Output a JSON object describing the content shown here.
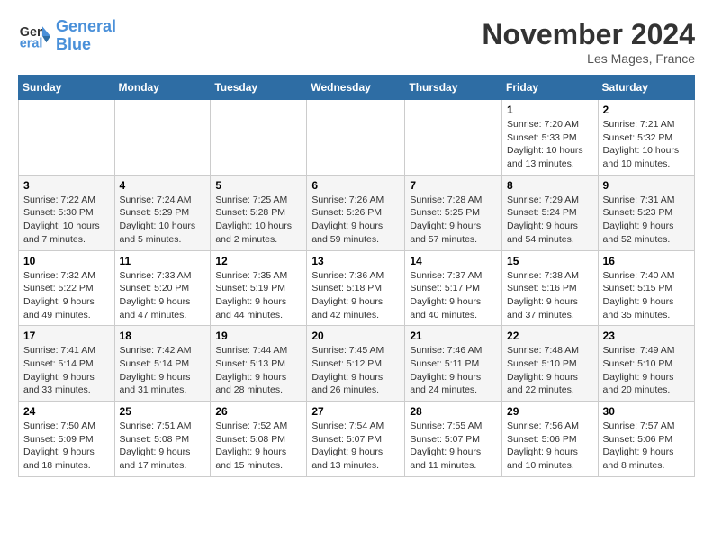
{
  "logo": {
    "line1": "General",
    "line2": "Blue"
  },
  "title": "November 2024",
  "location": "Les Mages, France",
  "days_of_week": [
    "Sunday",
    "Monday",
    "Tuesday",
    "Wednesday",
    "Thursday",
    "Friday",
    "Saturday"
  ],
  "weeks": [
    [
      {
        "day": "",
        "info": ""
      },
      {
        "day": "",
        "info": ""
      },
      {
        "day": "",
        "info": ""
      },
      {
        "day": "",
        "info": ""
      },
      {
        "day": "",
        "info": ""
      },
      {
        "day": "1",
        "info": "Sunrise: 7:20 AM\nSunset: 5:33 PM\nDaylight: 10 hours\nand 13 minutes."
      },
      {
        "day": "2",
        "info": "Sunrise: 7:21 AM\nSunset: 5:32 PM\nDaylight: 10 hours\nand 10 minutes."
      }
    ],
    [
      {
        "day": "3",
        "info": "Sunrise: 7:22 AM\nSunset: 5:30 PM\nDaylight: 10 hours\nand 7 minutes."
      },
      {
        "day": "4",
        "info": "Sunrise: 7:24 AM\nSunset: 5:29 PM\nDaylight: 10 hours\nand 5 minutes."
      },
      {
        "day": "5",
        "info": "Sunrise: 7:25 AM\nSunset: 5:28 PM\nDaylight: 10 hours\nand 2 minutes."
      },
      {
        "day": "6",
        "info": "Sunrise: 7:26 AM\nSunset: 5:26 PM\nDaylight: 9 hours\nand 59 minutes."
      },
      {
        "day": "7",
        "info": "Sunrise: 7:28 AM\nSunset: 5:25 PM\nDaylight: 9 hours\nand 57 minutes."
      },
      {
        "day": "8",
        "info": "Sunrise: 7:29 AM\nSunset: 5:24 PM\nDaylight: 9 hours\nand 54 minutes."
      },
      {
        "day": "9",
        "info": "Sunrise: 7:31 AM\nSunset: 5:23 PM\nDaylight: 9 hours\nand 52 minutes."
      }
    ],
    [
      {
        "day": "10",
        "info": "Sunrise: 7:32 AM\nSunset: 5:22 PM\nDaylight: 9 hours\nand 49 minutes."
      },
      {
        "day": "11",
        "info": "Sunrise: 7:33 AM\nSunset: 5:20 PM\nDaylight: 9 hours\nand 47 minutes."
      },
      {
        "day": "12",
        "info": "Sunrise: 7:35 AM\nSunset: 5:19 PM\nDaylight: 9 hours\nand 44 minutes."
      },
      {
        "day": "13",
        "info": "Sunrise: 7:36 AM\nSunset: 5:18 PM\nDaylight: 9 hours\nand 42 minutes."
      },
      {
        "day": "14",
        "info": "Sunrise: 7:37 AM\nSunset: 5:17 PM\nDaylight: 9 hours\nand 40 minutes."
      },
      {
        "day": "15",
        "info": "Sunrise: 7:38 AM\nSunset: 5:16 PM\nDaylight: 9 hours\nand 37 minutes."
      },
      {
        "day": "16",
        "info": "Sunrise: 7:40 AM\nSunset: 5:15 PM\nDaylight: 9 hours\nand 35 minutes."
      }
    ],
    [
      {
        "day": "17",
        "info": "Sunrise: 7:41 AM\nSunset: 5:14 PM\nDaylight: 9 hours\nand 33 minutes."
      },
      {
        "day": "18",
        "info": "Sunrise: 7:42 AM\nSunset: 5:14 PM\nDaylight: 9 hours\nand 31 minutes."
      },
      {
        "day": "19",
        "info": "Sunrise: 7:44 AM\nSunset: 5:13 PM\nDaylight: 9 hours\nand 28 minutes."
      },
      {
        "day": "20",
        "info": "Sunrise: 7:45 AM\nSunset: 5:12 PM\nDaylight: 9 hours\nand 26 minutes."
      },
      {
        "day": "21",
        "info": "Sunrise: 7:46 AM\nSunset: 5:11 PM\nDaylight: 9 hours\nand 24 minutes."
      },
      {
        "day": "22",
        "info": "Sunrise: 7:48 AM\nSunset: 5:10 PM\nDaylight: 9 hours\nand 22 minutes."
      },
      {
        "day": "23",
        "info": "Sunrise: 7:49 AM\nSunset: 5:10 PM\nDaylight: 9 hours\nand 20 minutes."
      }
    ],
    [
      {
        "day": "24",
        "info": "Sunrise: 7:50 AM\nSunset: 5:09 PM\nDaylight: 9 hours\nand 18 minutes."
      },
      {
        "day": "25",
        "info": "Sunrise: 7:51 AM\nSunset: 5:08 PM\nDaylight: 9 hours\nand 17 minutes."
      },
      {
        "day": "26",
        "info": "Sunrise: 7:52 AM\nSunset: 5:08 PM\nDaylight: 9 hours\nand 15 minutes."
      },
      {
        "day": "27",
        "info": "Sunrise: 7:54 AM\nSunset: 5:07 PM\nDaylight: 9 hours\nand 13 minutes."
      },
      {
        "day": "28",
        "info": "Sunrise: 7:55 AM\nSunset: 5:07 PM\nDaylight: 9 hours\nand 11 minutes."
      },
      {
        "day": "29",
        "info": "Sunrise: 7:56 AM\nSunset: 5:06 PM\nDaylight: 9 hours\nand 10 minutes."
      },
      {
        "day": "30",
        "info": "Sunrise: 7:57 AM\nSunset: 5:06 PM\nDaylight: 9 hours\nand 8 minutes."
      }
    ]
  ]
}
